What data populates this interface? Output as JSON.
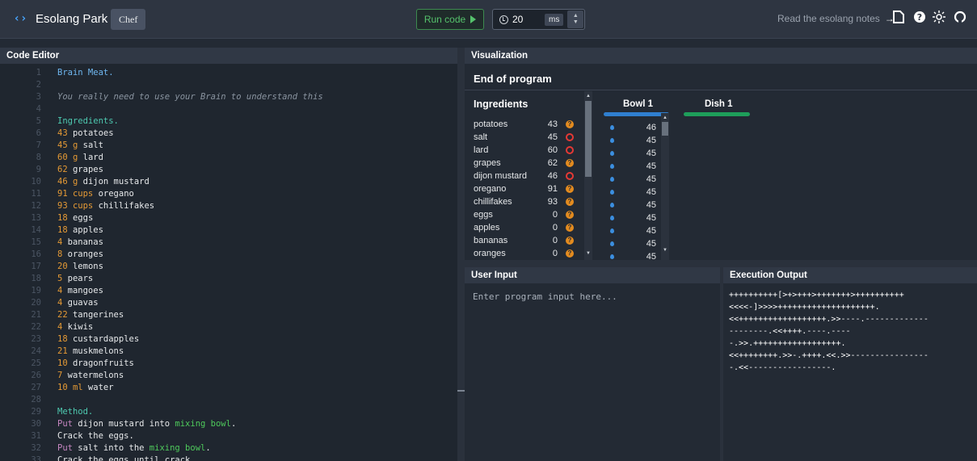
{
  "header": {
    "app_name": "Esolang Park",
    "logo_glyph": "‹›",
    "language": "Chef",
    "run_label": "Run code",
    "speed_value": "20",
    "speed_unit": "ms",
    "notes_link": "Read the esolang notes",
    "notes_arrow": "→"
  },
  "editor": {
    "title": "Code Editor",
    "lines": [
      {
        "n": "1",
        "parts": [
          {
            "t": "Brain Meat.",
            "c": "t-title"
          }
        ]
      },
      {
        "n": "2",
        "parts": []
      },
      {
        "n": "3",
        "parts": [
          {
            "t": "You really need to use your Brain to understand this",
            "c": "t-comment"
          }
        ]
      },
      {
        "n": "4",
        "parts": []
      },
      {
        "n": "5",
        "parts": [
          {
            "t": "Ingredients.",
            "c": "t-head"
          }
        ]
      },
      {
        "n": "6",
        "parts": [
          {
            "t": "43",
            "c": "t-num"
          },
          {
            "t": " potatoes",
            "c": ""
          }
        ]
      },
      {
        "n": "7",
        "parts": [
          {
            "t": "45 g",
            "c": "t-num"
          },
          {
            "t": " salt",
            "c": ""
          }
        ]
      },
      {
        "n": "8",
        "parts": [
          {
            "t": "60 g",
            "c": "t-num"
          },
          {
            "t": " lard",
            "c": ""
          }
        ]
      },
      {
        "n": "9",
        "parts": [
          {
            "t": "62",
            "c": "t-num"
          },
          {
            "t": " grapes",
            "c": ""
          }
        ]
      },
      {
        "n": "10",
        "parts": [
          {
            "t": "46 g",
            "c": "t-num"
          },
          {
            "t": " dijon mustard",
            "c": ""
          }
        ]
      },
      {
        "n": "11",
        "parts": [
          {
            "t": "91 cups",
            "c": "t-num"
          },
          {
            "t": " oregano",
            "c": ""
          }
        ]
      },
      {
        "n": "12",
        "parts": [
          {
            "t": "93 cups",
            "c": "t-num"
          },
          {
            "t": " chillifakes",
            "c": ""
          }
        ]
      },
      {
        "n": "13",
        "parts": [
          {
            "t": "18",
            "c": "t-num"
          },
          {
            "t": " eggs",
            "c": ""
          }
        ]
      },
      {
        "n": "14",
        "parts": [
          {
            "t": "18",
            "c": "t-num"
          },
          {
            "t": " apples",
            "c": ""
          }
        ]
      },
      {
        "n": "15",
        "parts": [
          {
            "t": "4",
            "c": "t-num"
          },
          {
            "t": " bananas",
            "c": ""
          }
        ]
      },
      {
        "n": "16",
        "parts": [
          {
            "t": "8",
            "c": "t-num"
          },
          {
            "t": " oranges",
            "c": ""
          }
        ]
      },
      {
        "n": "17",
        "parts": [
          {
            "t": "20",
            "c": "t-num"
          },
          {
            "t": " lemons",
            "c": ""
          }
        ]
      },
      {
        "n": "18",
        "parts": [
          {
            "t": "5",
            "c": "t-num"
          },
          {
            "t": " pears",
            "c": ""
          }
        ]
      },
      {
        "n": "19",
        "parts": [
          {
            "t": "4",
            "c": "t-num"
          },
          {
            "t": " mangoes",
            "c": ""
          }
        ]
      },
      {
        "n": "20",
        "parts": [
          {
            "t": "4",
            "c": "t-num"
          },
          {
            "t": " guavas",
            "c": ""
          }
        ]
      },
      {
        "n": "21",
        "parts": [
          {
            "t": "22",
            "c": "t-num"
          },
          {
            "t": " tangerines",
            "c": ""
          }
        ]
      },
      {
        "n": "22",
        "parts": [
          {
            "t": "4",
            "c": "t-num"
          },
          {
            "t": " kiwis",
            "c": ""
          }
        ]
      },
      {
        "n": "23",
        "parts": [
          {
            "t": "18",
            "c": "t-num"
          },
          {
            "t": " custardapples",
            "c": ""
          }
        ]
      },
      {
        "n": "24",
        "parts": [
          {
            "t": "21",
            "c": "t-num"
          },
          {
            "t": " muskmelons",
            "c": ""
          }
        ]
      },
      {
        "n": "25",
        "parts": [
          {
            "t": "10",
            "c": "t-num"
          },
          {
            "t": " dragonfruits",
            "c": ""
          }
        ]
      },
      {
        "n": "26",
        "parts": [
          {
            "t": "7",
            "c": "t-num"
          },
          {
            "t": " watermelons",
            "c": ""
          }
        ]
      },
      {
        "n": "27",
        "parts": [
          {
            "t": "10 ml",
            "c": "t-num"
          },
          {
            "t": " water",
            "c": ""
          }
        ]
      },
      {
        "n": "28",
        "parts": []
      },
      {
        "n": "29",
        "parts": [
          {
            "t": "Method.",
            "c": "t-head"
          }
        ]
      },
      {
        "n": "30",
        "parts": [
          {
            "t": "Put",
            "c": "t-kw"
          },
          {
            "t": " dijon mustard into ",
            "c": ""
          },
          {
            "t": "mixing bowl",
            "c": "t-grn"
          },
          {
            "t": ".",
            "c": ""
          }
        ]
      },
      {
        "n": "31",
        "parts": [
          {
            "t": "Crack the eggs.",
            "c": ""
          }
        ]
      },
      {
        "n": "32",
        "parts": [
          {
            "t": "Put",
            "c": "t-kw"
          },
          {
            "t": " salt into the ",
            "c": ""
          },
          {
            "t": "mixing bowl",
            "c": "t-grn"
          },
          {
            "t": ".",
            "c": ""
          }
        ]
      },
      {
        "n": "33",
        "parts": [
          {
            "t": "Crack the eggs until crack.",
            "c": ""
          }
        ]
      }
    ]
  },
  "visualization": {
    "title": "Visualization",
    "status": "End of program",
    "ingredients_title": "Ingredients",
    "ingredients": [
      {
        "name": "potatoes",
        "value": "43",
        "kind": "dry"
      },
      {
        "name": "salt",
        "value": "45",
        "kind": "liquid"
      },
      {
        "name": "lard",
        "value": "60",
        "kind": "liquid"
      },
      {
        "name": "grapes",
        "value": "62",
        "kind": "dry"
      },
      {
        "name": "dijon mustard",
        "value": "46",
        "kind": "liquid"
      },
      {
        "name": "oregano",
        "value": "91",
        "kind": "dry"
      },
      {
        "name": "chillifakes",
        "value": "93",
        "kind": "dry"
      },
      {
        "name": "eggs",
        "value": "0",
        "kind": "dry"
      },
      {
        "name": "apples",
        "value": "0",
        "kind": "dry"
      },
      {
        "name": "bananas",
        "value": "0",
        "kind": "dry"
      },
      {
        "name": "oranges",
        "value": "0",
        "kind": "dry"
      }
    ],
    "bowl": {
      "title": "Bowl 1",
      "color": "#2f7fd0",
      "values": [
        "46",
        "45",
        "45",
        "45",
        "45",
        "45",
        "45",
        "45",
        "45",
        "45",
        "45"
      ]
    },
    "dish": {
      "title": "Dish 1",
      "color": "#1e9e5a"
    }
  },
  "input": {
    "title": "User Input",
    "placeholder": "Enter program input here..."
  },
  "output": {
    "title": "Execution Output",
    "lines": [
      "++++++++++[>+>+++>+++++++>++++++++++",
      "<<<<-]>>>>++++++++++++++++++++.",
      "<<++++++++++++++++++.>>----.-------------",
      "--------.<<++++.----.----",
      "-.>>.++++++++++++++++++.",
      "<<++++++++.>>-.++++.<<.>>----------------",
      "-.<<-----------------."
    ]
  },
  "colors": {
    "accent": "#48a6ff",
    "run_green": "#55c26c",
    "dry_icon": "#e38b1f",
    "liquid_icon": "#e53935"
  }
}
